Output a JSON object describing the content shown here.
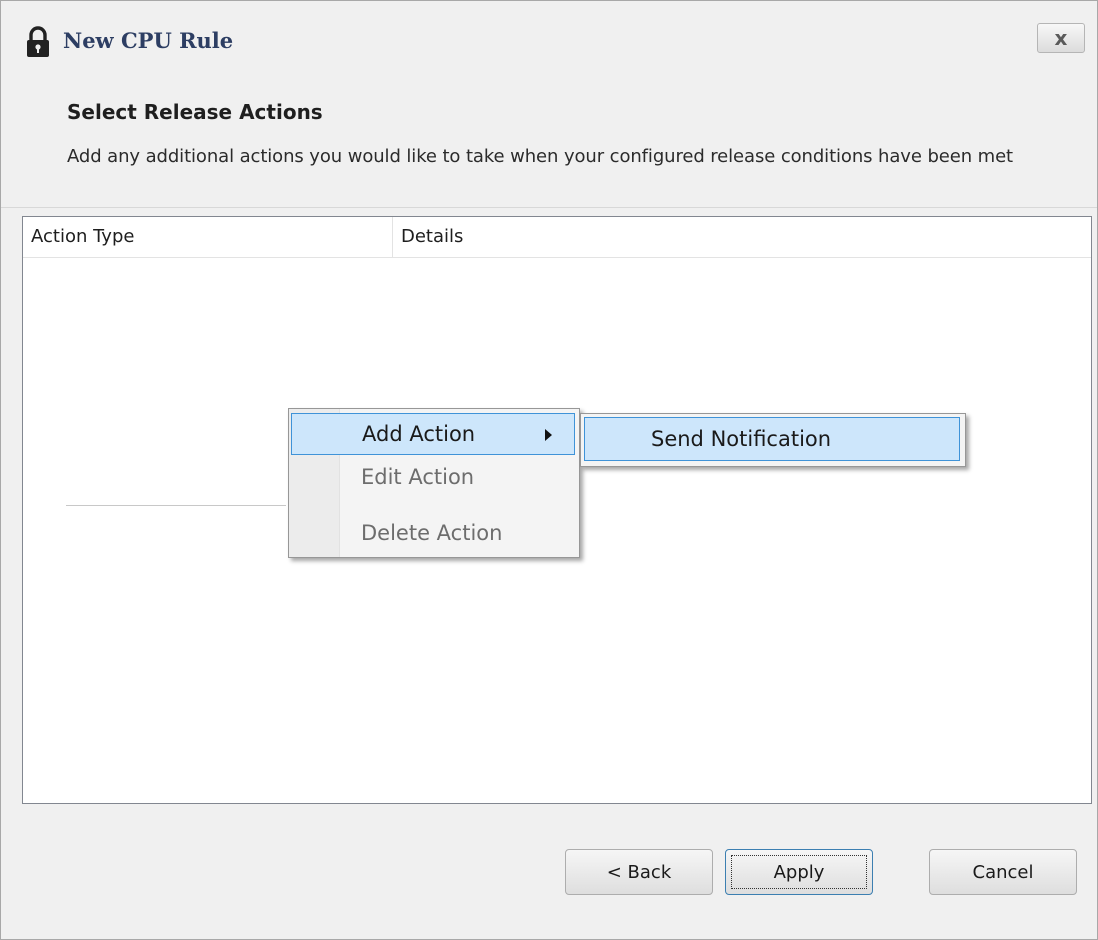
{
  "window": {
    "title": "New CPU Rule",
    "close_label": "x"
  },
  "page": {
    "heading": "Select Release Actions",
    "description": "Add any additional actions you would like to take when your configured release conditions have been met"
  },
  "table": {
    "columns": [
      "Action Type",
      "Details"
    ],
    "rows": []
  },
  "context_menu": {
    "items": [
      {
        "label": "Add Action",
        "state": "highlighted",
        "has_submenu": true
      },
      {
        "label": "Edit Action",
        "state": "disabled"
      },
      {
        "label": "Delete Action",
        "state": "disabled"
      }
    ],
    "submenu": {
      "items": [
        {
          "label": "Send Notification",
          "state": "highlighted"
        }
      ]
    }
  },
  "buttons": {
    "back": "< Back",
    "apply": "Apply",
    "cancel": "Cancel"
  },
  "colors": {
    "highlight_bg": "#cde6fb",
    "highlight_border": "#3f93d8",
    "title_color": "#2d3e63"
  }
}
